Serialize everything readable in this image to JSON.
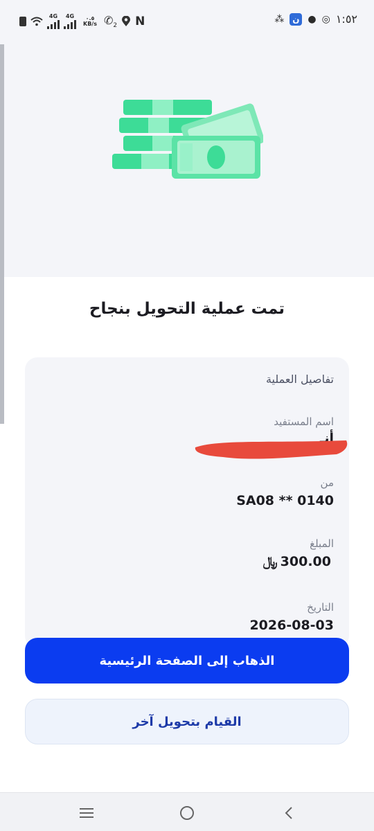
{
  "status_bar": {
    "network_1": "4G",
    "network_2": "4G",
    "speed_value": "٠.٥",
    "speed_unit": "KB/s",
    "call_sim": "2",
    "nfc": "N",
    "time": "١:٥٢",
    "app_badge": "ن"
  },
  "hero": {
    "illustration": "money-stack-icon",
    "accent": "#3ddc97"
  },
  "title": "تمت عملية التحويل بنجاح",
  "details": {
    "heading": "تفاصيل العملية",
    "beneficiary_label": "اسم المستفيد",
    "beneficiary_value": "أنـ",
    "from_label": "من",
    "from_value": "SA08 ** 0140",
    "amount_label": "المبلغ",
    "amount_value": "300.00",
    "currency_symbol": "﷼",
    "date_label": "التاريخ",
    "date_value": "2026-08-03"
  },
  "actions": {
    "home_label": "الذهاب إلى الصفحة الرئيسية",
    "another_label": "القيام بتحويل آخر"
  },
  "colors": {
    "primary": "#0b3cf0",
    "secondary_bg": "#eef3fc",
    "redaction": "#e84a3c"
  }
}
